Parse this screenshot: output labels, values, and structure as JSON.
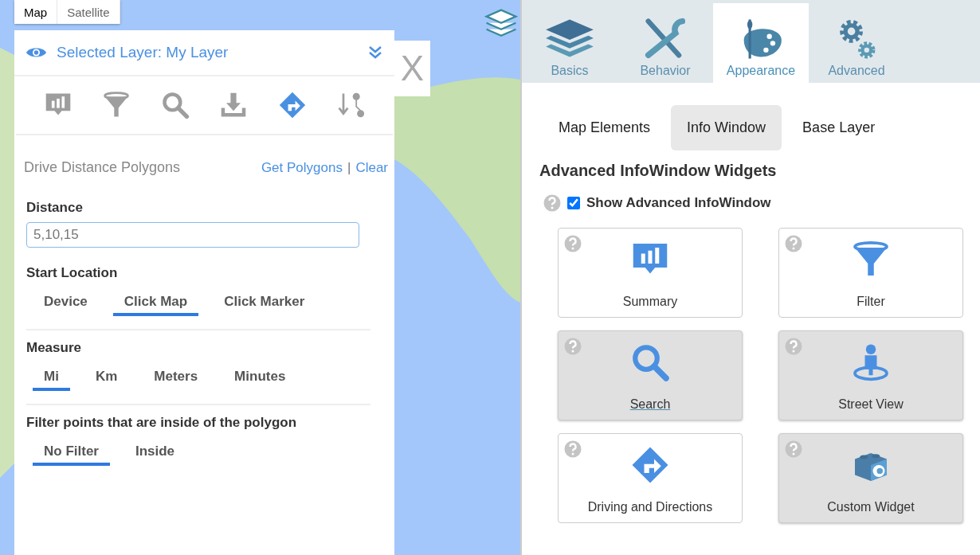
{
  "map_type_tabs": [
    {
      "label": "Map",
      "selected": true
    },
    {
      "label": "Satellite",
      "selected": false
    }
  ],
  "close_button": {
    "label": "X"
  },
  "layer_panel": {
    "header": "Selected Layer: My Layer",
    "toolbar": [
      {
        "kind": "summary",
        "selected": false
      },
      {
        "kind": "filter",
        "selected": false
      },
      {
        "kind": "search",
        "selected": false
      },
      {
        "kind": "download",
        "selected": false
      },
      {
        "kind": "directions",
        "selected": true
      },
      {
        "kind": "sort",
        "selected": false
      }
    ],
    "title": "Drive Distance Polygons",
    "get_link": "Get Polygons",
    "separator": "|",
    "clear_link": "Clear",
    "distance": {
      "label": "Distance",
      "value": "5,10,15"
    },
    "groups": [
      {
        "label": "Start Location",
        "options": [
          {
            "label": "Device",
            "selected": false
          },
          {
            "label": "Click Map",
            "selected": true
          },
          {
            "label": "Click Marker",
            "selected": false
          }
        ]
      },
      {
        "label": "Measure",
        "options": [
          {
            "label": "Mi",
            "selected": true
          },
          {
            "label": "Km",
            "selected": false
          },
          {
            "label": "Meters",
            "selected": false
          },
          {
            "label": "Minutes",
            "selected": false
          }
        ]
      },
      {
        "label": "Filter points that are inside of the polygon",
        "options": [
          {
            "label": "No Filter",
            "selected": true
          },
          {
            "label": "Inside",
            "selected": false
          }
        ]
      }
    ]
  },
  "settings_tabs": [
    {
      "kind": "layers",
      "label": "Basics",
      "selected": false
    },
    {
      "kind": "tools",
      "label": "Behavior",
      "selected": false
    },
    {
      "kind": "palette",
      "label": "Appearance",
      "selected": true
    },
    {
      "kind": "gears",
      "label": "Advanced",
      "selected": false
    }
  ],
  "sub_tabs": [
    {
      "label": "Map Elements",
      "selected": false
    },
    {
      "label": "Info Window",
      "selected": true
    },
    {
      "label": "Base Layer",
      "selected": false
    }
  ],
  "section_title": "Advanced InfoWindow Widgets",
  "show_advanced": {
    "label": "Show Advanced InfoWindow",
    "checked": true
  },
  "widgets": [
    {
      "kind": "summary",
      "label": "Summary",
      "enabled": true,
      "underlined": false
    },
    {
      "kind": "filter",
      "label": "Filter",
      "enabled": true,
      "underlined": false
    },
    {
      "kind": "search",
      "label": "Search",
      "enabled": false,
      "underlined": true
    },
    {
      "kind": "streetview",
      "label": "Street View",
      "enabled": false,
      "underlined": false
    },
    {
      "kind": "directions",
      "label": "Driving and Directions",
      "enabled": true,
      "underlined": false
    },
    {
      "kind": "custom",
      "label": "Custom Widget",
      "enabled": false,
      "underlined": false
    }
  ]
}
